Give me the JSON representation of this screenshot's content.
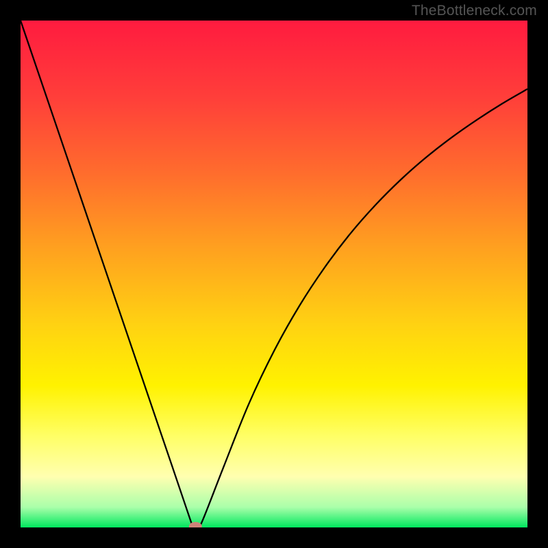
{
  "watermark": "TheBottleneck.com",
  "chart_data": {
    "type": "line",
    "title": "",
    "xlabel": "",
    "ylabel": "",
    "xlim": [
      0,
      100
    ],
    "ylim": [
      0,
      100
    ],
    "grid": false,
    "legend": false,
    "series": [
      {
        "name": "bottleneck-curve",
        "color": "#000000",
        "x": [
          0,
          5,
          10,
          15,
          20,
          25,
          30,
          34,
          35,
          36,
          40,
          45,
          50,
          55,
          60,
          65,
          70,
          75,
          80,
          85,
          90,
          95,
          100
        ],
        "y": [
          100,
          85.3,
          70.6,
          55.9,
          41.2,
          26.5,
          11.8,
          0,
          0,
          1.6,
          11.8,
          24.3,
          34.8,
          43.7,
          51.3,
          57.9,
          63.6,
          68.6,
          73.0,
          76.9,
          80.4,
          83.6,
          86.5
        ]
      }
    ],
    "marker": {
      "name": "optimal-point",
      "x": 34.5,
      "y": 0.2,
      "color": "#cd8379",
      "shape": "ellipse"
    },
    "gradient_stops": [
      {
        "offset": 0.0,
        "color": "#ff1b3f"
      },
      {
        "offset": 0.15,
        "color": "#ff3e3a"
      },
      {
        "offset": 0.3,
        "color": "#ff6c2d"
      },
      {
        "offset": 0.45,
        "color": "#ffa11f"
      },
      {
        "offset": 0.6,
        "color": "#ffd212"
      },
      {
        "offset": 0.72,
        "color": "#fff200"
      },
      {
        "offset": 0.82,
        "color": "#ffff66"
      },
      {
        "offset": 0.9,
        "color": "#ffffb0"
      },
      {
        "offset": 0.96,
        "color": "#aaffaa"
      },
      {
        "offset": 1.0,
        "color": "#00e85e"
      }
    ]
  }
}
